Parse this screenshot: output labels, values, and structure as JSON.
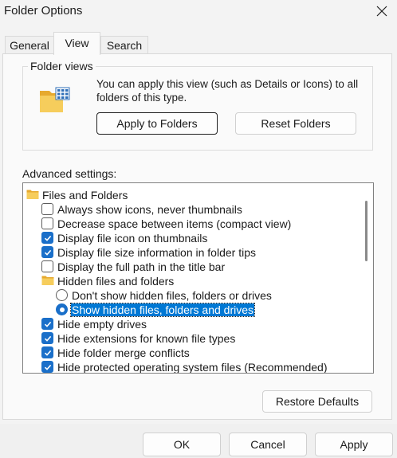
{
  "window": {
    "title": "Folder Options",
    "close_icon": "close-icon"
  },
  "tabs": [
    {
      "label": "General",
      "active": false
    },
    {
      "label": "View",
      "active": true
    },
    {
      "label": "Search",
      "active": false
    }
  ],
  "folder_views": {
    "legend": "Folder views",
    "description": "You can apply this view (such as Details or Icons) to all folders of this type.",
    "apply_label": "Apply to Folders",
    "reset_label": "Reset Folders"
  },
  "advanced": {
    "label": "Advanced settings:",
    "items": [
      {
        "type": "folder",
        "label": "Files and Folders",
        "indent": 0
      },
      {
        "type": "checkbox",
        "label": "Always show icons, never thumbnails",
        "checked": false,
        "indent": 1
      },
      {
        "type": "checkbox",
        "label": "Decrease space between items (compact view)",
        "checked": false,
        "indent": 1
      },
      {
        "type": "checkbox",
        "label": "Display file icon on thumbnails",
        "checked": true,
        "indent": 1
      },
      {
        "type": "checkbox",
        "label": "Display file size information in folder tips",
        "checked": true,
        "indent": 1
      },
      {
        "type": "checkbox",
        "label": "Display the full path in the title bar",
        "checked": false,
        "indent": 1
      },
      {
        "type": "folder",
        "label": "Hidden files and folders",
        "indent": 1
      },
      {
        "type": "radio",
        "label": "Don't show hidden files, folders or drives",
        "checked": false,
        "indent": 2
      },
      {
        "type": "radio",
        "label": "Show hidden files, folders and drives",
        "checked": true,
        "indent": 2,
        "selected": true
      },
      {
        "type": "checkbox",
        "label": "Hide empty drives",
        "checked": true,
        "indent": 1
      },
      {
        "type": "checkbox",
        "label": "Hide extensions for known file types",
        "checked": true,
        "indent": 1
      },
      {
        "type": "checkbox",
        "label": "Hide folder merge conflicts",
        "checked": true,
        "indent": 1
      },
      {
        "type": "checkbox",
        "label": "Hide protected operating system files (Recommended)",
        "checked": true,
        "indent": 1
      }
    ],
    "restore_label": "Restore Defaults"
  },
  "footer": {
    "ok_label": "OK",
    "cancel_label": "Cancel",
    "apply_label": "Apply"
  },
  "colors": {
    "accent": "#1a6fc9",
    "selection": "#0078d4",
    "folder": "#f2c14e"
  }
}
